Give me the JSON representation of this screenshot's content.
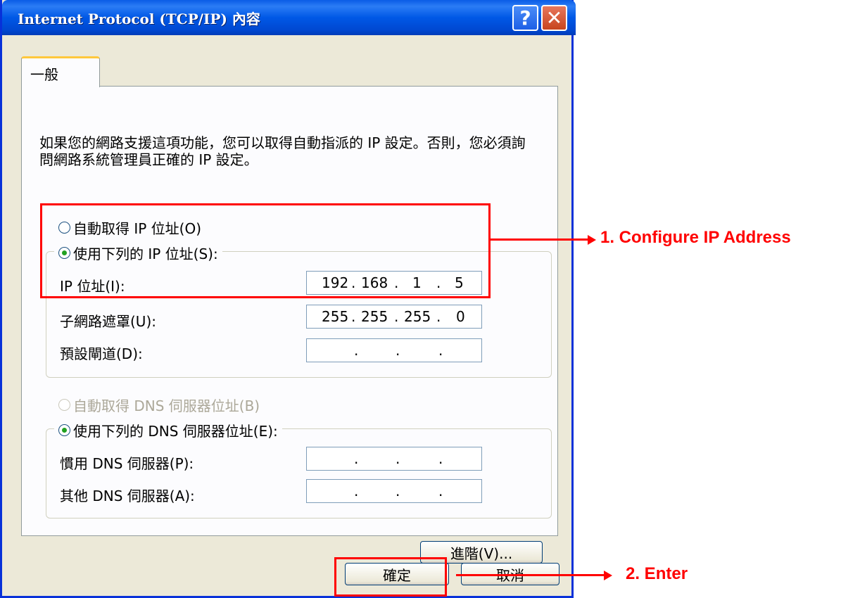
{
  "window": {
    "title": "Internet Protocol (TCP/IP) 內容",
    "help_label": "?",
    "close_label": "✕"
  },
  "tabs": [
    {
      "label": "一般",
      "active": true
    }
  ],
  "description": "如果您的網路支援這項功能，您可以取得自動指派的 IP 設定。否則，您必須詢問網路系統管理員正確的 IP 設定。",
  "ip_section": {
    "auto_option": "自動取得 IP 位址(O)",
    "manual_option": "使用下列的 IP 位址(S):",
    "selected": "manual",
    "fields": [
      {
        "label": "IP 位址(I):",
        "octets": [
          "192",
          "168",
          "1",
          "5"
        ]
      },
      {
        "label": "子網路遮罩(U):",
        "octets": [
          "255",
          "255",
          "255",
          "0"
        ]
      },
      {
        "label": "預設閘道(D):",
        "octets": [
          "",
          "",
          "",
          ""
        ]
      }
    ]
  },
  "dns_section": {
    "auto_option": "自動取得 DNS 伺服器位址(B)",
    "auto_disabled": true,
    "manual_option": "使用下列的 DNS 伺服器位址(E):",
    "selected": "manual",
    "fields": [
      {
        "label": "慣用 DNS 伺服器(P):",
        "octets": [
          "",
          "",
          "",
          ""
        ]
      },
      {
        "label": "其他 DNS 伺服器(A):",
        "octets": [
          "",
          "",
          "",
          ""
        ]
      }
    ]
  },
  "buttons": {
    "advanced": "進階(V)...",
    "ok": "確定",
    "cancel": "取消"
  },
  "annotations": {
    "step1": "1. Configure IP Address",
    "step2": "2. Enter",
    "color": "#ff0000"
  }
}
